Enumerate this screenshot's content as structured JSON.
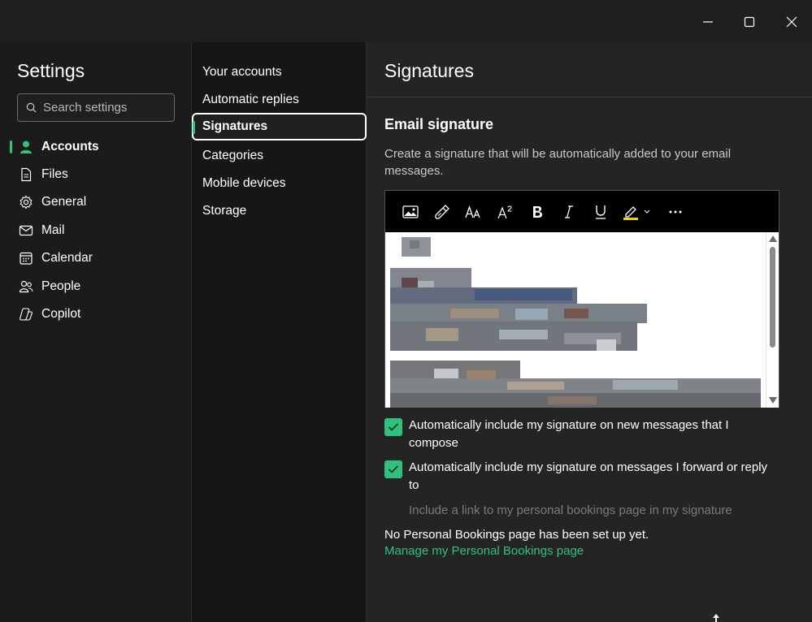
{
  "window": {
    "controls": [
      "minimize-icon",
      "maximize-icon",
      "close-icon"
    ]
  },
  "sidebar": {
    "title": "Settings",
    "search_placeholder": "Search settings",
    "items": [
      {
        "label": "Accounts",
        "icon": "person-icon",
        "active": true
      },
      {
        "label": "Files",
        "icon": "file-icon",
        "active": false
      },
      {
        "label": "General",
        "icon": "gear-icon",
        "active": false
      },
      {
        "label": "Mail",
        "icon": "mail-icon",
        "active": false
      },
      {
        "label": "Calendar",
        "icon": "calendar-icon",
        "active": false
      },
      {
        "label": "People",
        "icon": "people-icon",
        "active": false
      },
      {
        "label": "Copilot",
        "icon": "copilot-icon",
        "active": false
      }
    ]
  },
  "subnav": {
    "items": [
      {
        "label": "Your accounts",
        "active": false
      },
      {
        "label": "Automatic replies",
        "active": false
      },
      {
        "label": "Signatures",
        "active": true
      },
      {
        "label": "Categories",
        "active": false
      },
      {
        "label": "Mobile devices",
        "active": false
      },
      {
        "label": "Storage",
        "active": false
      }
    ]
  },
  "main": {
    "title": "Signatures",
    "section_title": "Email signature",
    "description": "Create a signature that will be automatically added to your email messages.",
    "toolbar": [
      "image-icon",
      "format-painter-icon",
      "font-size-icon",
      "superscript-icon",
      "bold-icon",
      "italic-icon",
      "underline-icon",
      "highlight-icon",
      "more-icon"
    ],
    "checkboxes": [
      {
        "label": "Automatically include my signature on new messages that I compose",
        "checked": true
      },
      {
        "label": "Automatically include my signature on messages I forward or reply to",
        "checked": true
      }
    ],
    "bookings_link_option": "Include a link to my personal bookings page in my signature",
    "no_bookings_text": "No Personal Bookings page has been set up yet.",
    "manage_link": "Manage my Personal Bookings page"
  },
  "colors": {
    "accent": "#2ec27e",
    "background": "#242424",
    "sidebar": "#1b1b1b"
  }
}
